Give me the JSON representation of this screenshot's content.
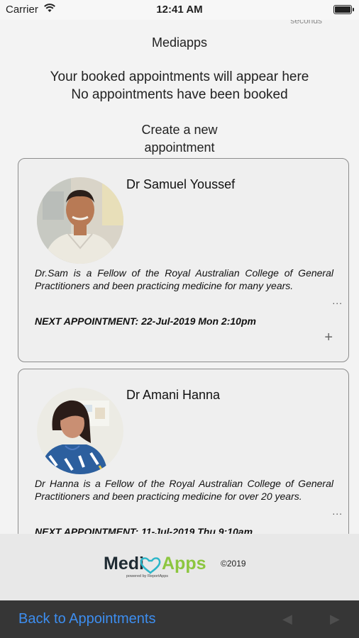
{
  "status_bar": {
    "carrier": "Carrier",
    "time": "12:41 AM"
  },
  "header": {
    "faded_text": "seconds",
    "app_name": "Mediapps",
    "info_line1": "Your booked appointments will appear here",
    "info_line2": "No appointments have been booked",
    "create_line1": "Create a new",
    "create_line2": "appointment"
  },
  "doctors": [
    {
      "name": "Dr Samuel Youssef",
      "description": "Dr.Sam is a Fellow of the Royal Australian College of General Practitioners and been practicing medicine for many years.",
      "ellipsis": "...",
      "next_appointment": "NEXT APPOINTMENT: 22-Jul-2019 Mon 2:10pm",
      "add": "+"
    },
    {
      "name": "Dr Amani Hanna",
      "description": "Dr Hanna is a Fellow of the Royal Australian College of General Practitioners and been practicing medicine for over 20 years.",
      "ellipsis": "...",
      "next_appointment": "NEXT APPOINTMENT: 11-Jul-2019 Thu 9:10am",
      "add": "+"
    }
  ],
  "footer": {
    "logo_left": "Medi",
    "logo_right": "Apps",
    "logo_tagline": "powered by ReportApps",
    "copyright": "©2019"
  },
  "nav": {
    "back_label": "Back to Appointments",
    "prev_icon": "◀",
    "next_icon": "▶"
  },
  "colors": {
    "link": "#3d8ef0",
    "logo_dark": "#1f2b33",
    "logo_green": "#8cc63f",
    "logo_heart": "#2bb6c9"
  }
}
